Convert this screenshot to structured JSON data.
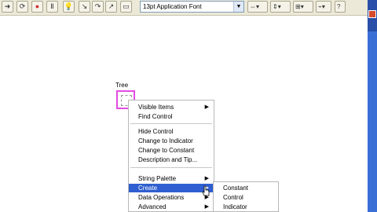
{
  "toolbar": {
    "buttons": [
      "run-arrow-icon",
      "run-continuous-icon",
      "abort-icon",
      "pause-icon",
      "bulb-icon",
      "step-into-icon",
      "step-over-icon",
      "step-out-icon"
    ],
    "font_select_value": "13pt Application Font"
  },
  "front_panel": {
    "control_label": "Tree"
  },
  "context_menu": {
    "items": [
      {
        "label": "Visible Items",
        "has_submenu": true
      },
      {
        "label": "Find Control",
        "has_submenu": false
      },
      {
        "label": "Hide Control",
        "has_submenu": false
      },
      {
        "label": "Change to Indicator",
        "has_submenu": false
      },
      {
        "label": "Change to Constant",
        "has_submenu": false
      },
      {
        "label": "Description and Tip...",
        "has_submenu": false
      },
      {
        "label": "String Palette",
        "has_submenu": true
      },
      {
        "label": "Create",
        "has_submenu": true,
        "highlighted": true
      },
      {
        "label": "Data Operations",
        "has_submenu": true
      },
      {
        "label": "Advanced",
        "has_submenu": true
      }
    ]
  },
  "submenu": {
    "items": [
      "Constant",
      "Control",
      "Indicator"
    ]
  },
  "colors": {
    "highlight": "#2f5fd0",
    "selection_border": "#e24ce0",
    "toolbar_bg": "#ece9d8"
  }
}
